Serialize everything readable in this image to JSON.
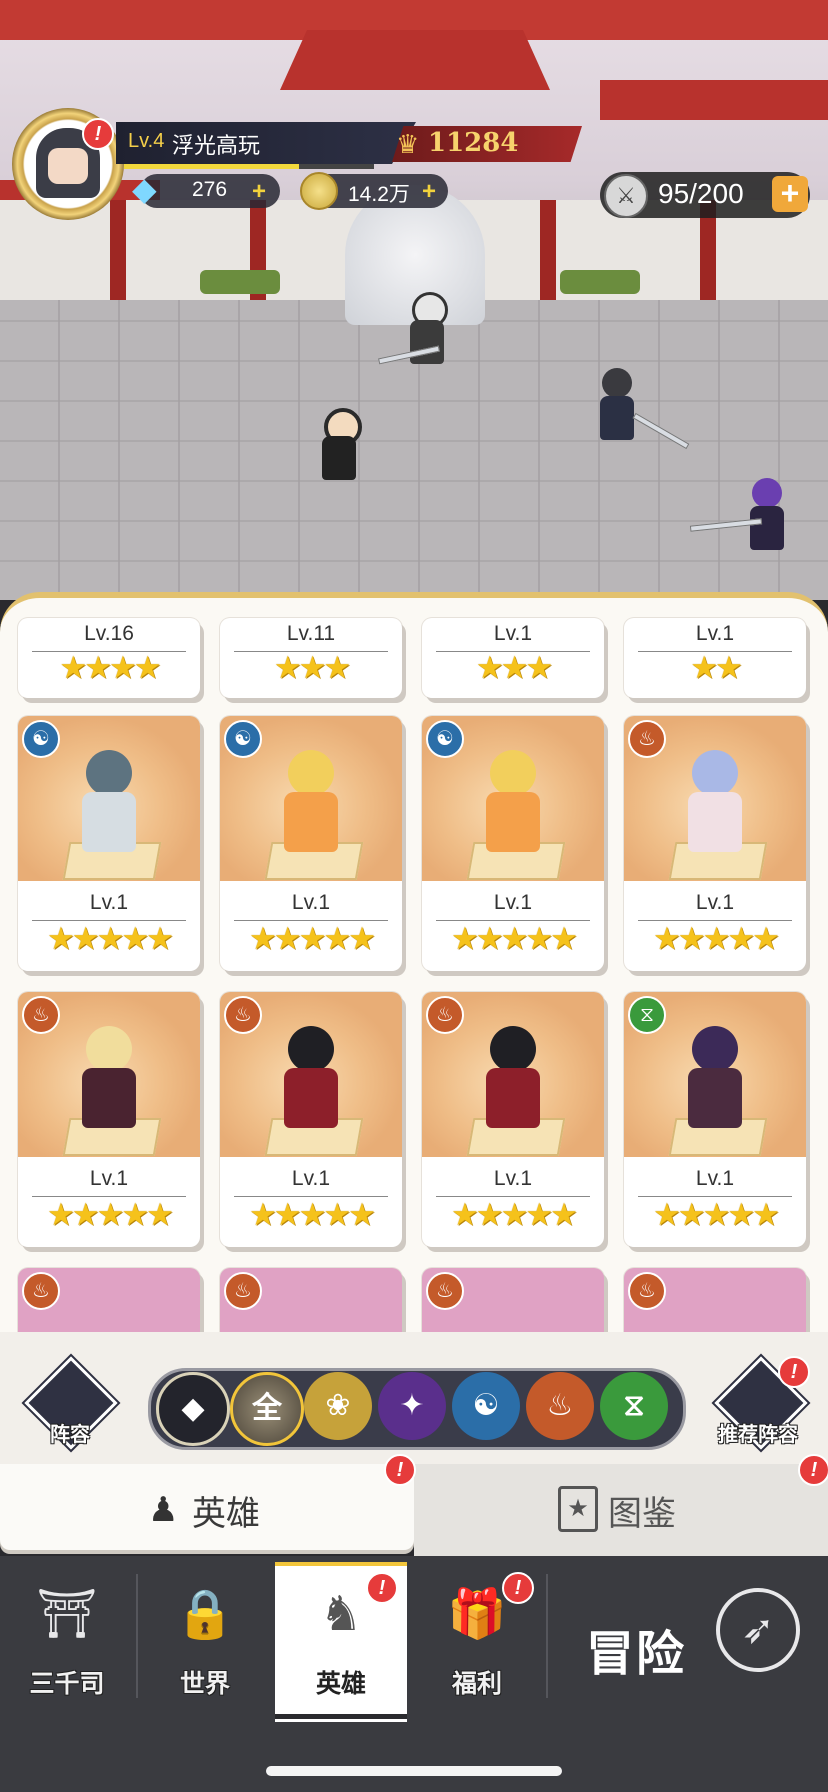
{
  "player": {
    "level": "Lv.4",
    "name": "浮光高玩",
    "power": "11284",
    "exp_fraction": 0.7,
    "avatar_alert": "!"
  },
  "resources": {
    "gems": "276",
    "gold": "14.2万",
    "plus": "+",
    "stamina": "95/200"
  },
  "heroes": {
    "top_row": [
      {
        "level": "Lv.16",
        "stars": "★★★★"
      },
      {
        "level": "Lv.11",
        "stars": "★★★"
      },
      {
        "level": "Lv.1",
        "stars": "★★★"
      },
      {
        "level": "Lv.1",
        "stars": "★★"
      }
    ],
    "row2": [
      {
        "level": "Lv.1",
        "stars": "★★★★★",
        "element": "water",
        "element_color": "#2b6ea8",
        "element_glyph": "☯"
      },
      {
        "level": "Lv.1",
        "stars": "★★★★★",
        "element": "water",
        "element_color": "#2b6ea8",
        "element_glyph": "☯"
      },
      {
        "level": "Lv.1",
        "stars": "★★★★★",
        "element": "water",
        "element_color": "#2b6ea8",
        "element_glyph": "☯"
      },
      {
        "level": "Lv.1",
        "stars": "★★★★★",
        "element": "fire",
        "element_color": "#c45a2a",
        "element_glyph": "♨"
      }
    ],
    "row3": [
      {
        "level": "Lv.1",
        "stars": "★★★★★",
        "element": "fire",
        "element_color": "#c45a2a",
        "element_glyph": "♨"
      },
      {
        "level": "Lv.1",
        "stars": "★★★★★",
        "element": "fire",
        "element_color": "#c45a2a",
        "element_glyph": "♨"
      },
      {
        "level": "Lv.1",
        "stars": "★★★★★",
        "element": "fire",
        "element_color": "#c45a2a",
        "element_glyph": "♨"
      },
      {
        "level": "Lv.1",
        "stars": "★★★★★",
        "element": "nature",
        "element_color": "#3a9a3c",
        "element_glyph": "⧖"
      }
    ]
  },
  "filters": {
    "lineup_label": "阵容",
    "all_label": "全",
    "recommend_label": "推荐阵容",
    "alert": "!"
  },
  "tabs": {
    "heroes": "英雄",
    "codex": "图鉴"
  },
  "nav": {
    "items": [
      "三千司",
      "世界",
      "英雄",
      "福利"
    ],
    "adventure": "冒险",
    "alert": "!"
  },
  "colors": {
    "accent_gold": "#f2c53a",
    "alert_red": "#e63b3b",
    "star": "#f5c21b"
  }
}
